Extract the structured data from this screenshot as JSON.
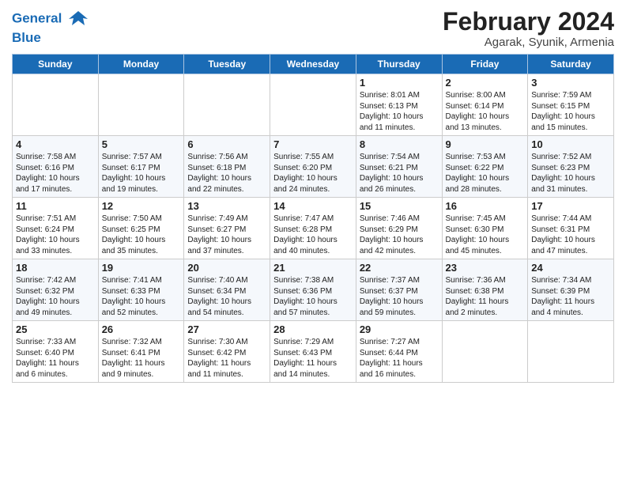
{
  "header": {
    "logo_line1": "General",
    "logo_line2": "Blue",
    "title": "February 2024",
    "subtitle": "Agarak, Syunik, Armenia"
  },
  "days_of_week": [
    "Sunday",
    "Monday",
    "Tuesday",
    "Wednesday",
    "Thursday",
    "Friday",
    "Saturday"
  ],
  "weeks": [
    [
      {
        "day": "",
        "info": ""
      },
      {
        "day": "",
        "info": ""
      },
      {
        "day": "",
        "info": ""
      },
      {
        "day": "",
        "info": ""
      },
      {
        "day": "1",
        "info": "Sunrise: 8:01 AM\nSunset: 6:13 PM\nDaylight: 10 hours\nand 11 minutes."
      },
      {
        "day": "2",
        "info": "Sunrise: 8:00 AM\nSunset: 6:14 PM\nDaylight: 10 hours\nand 13 minutes."
      },
      {
        "day": "3",
        "info": "Sunrise: 7:59 AM\nSunset: 6:15 PM\nDaylight: 10 hours\nand 15 minutes."
      }
    ],
    [
      {
        "day": "4",
        "info": "Sunrise: 7:58 AM\nSunset: 6:16 PM\nDaylight: 10 hours\nand 17 minutes."
      },
      {
        "day": "5",
        "info": "Sunrise: 7:57 AM\nSunset: 6:17 PM\nDaylight: 10 hours\nand 19 minutes."
      },
      {
        "day": "6",
        "info": "Sunrise: 7:56 AM\nSunset: 6:18 PM\nDaylight: 10 hours\nand 22 minutes."
      },
      {
        "day": "7",
        "info": "Sunrise: 7:55 AM\nSunset: 6:20 PM\nDaylight: 10 hours\nand 24 minutes."
      },
      {
        "day": "8",
        "info": "Sunrise: 7:54 AM\nSunset: 6:21 PM\nDaylight: 10 hours\nand 26 minutes."
      },
      {
        "day": "9",
        "info": "Sunrise: 7:53 AM\nSunset: 6:22 PM\nDaylight: 10 hours\nand 28 minutes."
      },
      {
        "day": "10",
        "info": "Sunrise: 7:52 AM\nSunset: 6:23 PM\nDaylight: 10 hours\nand 31 minutes."
      }
    ],
    [
      {
        "day": "11",
        "info": "Sunrise: 7:51 AM\nSunset: 6:24 PM\nDaylight: 10 hours\nand 33 minutes."
      },
      {
        "day": "12",
        "info": "Sunrise: 7:50 AM\nSunset: 6:25 PM\nDaylight: 10 hours\nand 35 minutes."
      },
      {
        "day": "13",
        "info": "Sunrise: 7:49 AM\nSunset: 6:27 PM\nDaylight: 10 hours\nand 37 minutes."
      },
      {
        "day": "14",
        "info": "Sunrise: 7:47 AM\nSunset: 6:28 PM\nDaylight: 10 hours\nand 40 minutes."
      },
      {
        "day": "15",
        "info": "Sunrise: 7:46 AM\nSunset: 6:29 PM\nDaylight: 10 hours\nand 42 minutes."
      },
      {
        "day": "16",
        "info": "Sunrise: 7:45 AM\nSunset: 6:30 PM\nDaylight: 10 hours\nand 45 minutes."
      },
      {
        "day": "17",
        "info": "Sunrise: 7:44 AM\nSunset: 6:31 PM\nDaylight: 10 hours\nand 47 minutes."
      }
    ],
    [
      {
        "day": "18",
        "info": "Sunrise: 7:42 AM\nSunset: 6:32 PM\nDaylight: 10 hours\nand 49 minutes."
      },
      {
        "day": "19",
        "info": "Sunrise: 7:41 AM\nSunset: 6:33 PM\nDaylight: 10 hours\nand 52 minutes."
      },
      {
        "day": "20",
        "info": "Sunrise: 7:40 AM\nSunset: 6:34 PM\nDaylight: 10 hours\nand 54 minutes."
      },
      {
        "day": "21",
        "info": "Sunrise: 7:38 AM\nSunset: 6:36 PM\nDaylight: 10 hours\nand 57 minutes."
      },
      {
        "day": "22",
        "info": "Sunrise: 7:37 AM\nSunset: 6:37 PM\nDaylight: 10 hours\nand 59 minutes."
      },
      {
        "day": "23",
        "info": "Sunrise: 7:36 AM\nSunset: 6:38 PM\nDaylight: 11 hours\nand 2 minutes."
      },
      {
        "day": "24",
        "info": "Sunrise: 7:34 AM\nSunset: 6:39 PM\nDaylight: 11 hours\nand 4 minutes."
      }
    ],
    [
      {
        "day": "25",
        "info": "Sunrise: 7:33 AM\nSunset: 6:40 PM\nDaylight: 11 hours\nand 6 minutes."
      },
      {
        "day": "26",
        "info": "Sunrise: 7:32 AM\nSunset: 6:41 PM\nDaylight: 11 hours\nand 9 minutes."
      },
      {
        "day": "27",
        "info": "Sunrise: 7:30 AM\nSunset: 6:42 PM\nDaylight: 11 hours\nand 11 minutes."
      },
      {
        "day": "28",
        "info": "Sunrise: 7:29 AM\nSunset: 6:43 PM\nDaylight: 11 hours\nand 14 minutes."
      },
      {
        "day": "29",
        "info": "Sunrise: 7:27 AM\nSunset: 6:44 PM\nDaylight: 11 hours\nand 16 minutes."
      },
      {
        "day": "",
        "info": ""
      },
      {
        "day": "",
        "info": ""
      }
    ]
  ]
}
